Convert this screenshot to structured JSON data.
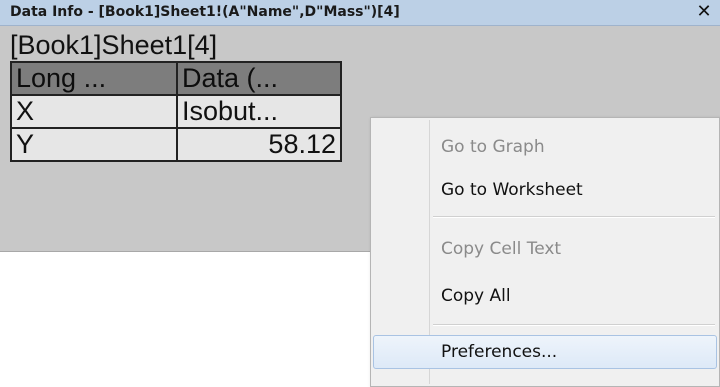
{
  "window": {
    "title": "Data Info - [Book1]Sheet1!(A\"Name\",D\"Mass\")[4]",
    "close_label": "✕",
    "book_label": "[Book1]Sheet1[4]"
  },
  "table": {
    "headers": [
      "Long ...",
      "Data (..."
    ],
    "rows": [
      [
        "X",
        "Isobut..."
      ],
      [
        "Y",
        "58.12"
      ]
    ]
  },
  "context_menu": {
    "items": [
      {
        "label": "Go to Graph",
        "enabled": false
      },
      {
        "label": "Go to Worksheet",
        "enabled": true
      },
      {
        "label": "Copy Cell Text",
        "enabled": false
      },
      {
        "label": "Copy All",
        "enabled": true
      },
      {
        "label": "Preferences...",
        "enabled": true,
        "highlighted": true
      }
    ]
  }
}
